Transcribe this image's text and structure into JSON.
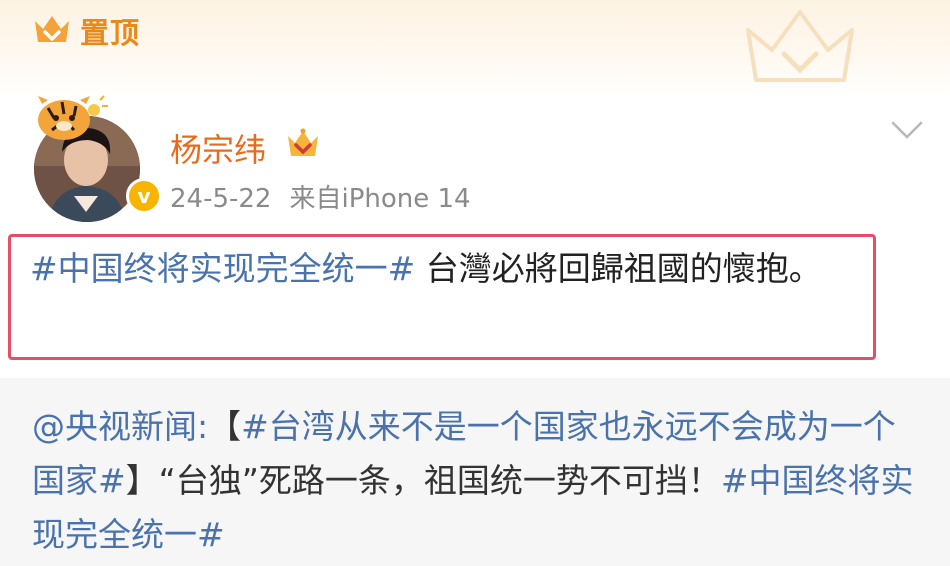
{
  "pinned": {
    "label": "置顶"
  },
  "post": {
    "username": "杨宗纬",
    "date": "24-5-22",
    "source": "来自iPhone 14",
    "topic_tag": "#中国终将实现完全统一#",
    "text": " 台灣必將回歸祖國的懷抱。"
  },
  "repost": {
    "mention": "@央视新闻:",
    "bracket_open": "【",
    "topic_tag": "#台湾从来不是一个国家也永远不会成为一个国家#",
    "bracket_close": "】",
    "body": "“台独”死路一条，祖国统一势不可挡！",
    "end_tag": "#中国终将实现完全统一#"
  },
  "colors": {
    "username": "#e86a1b",
    "link": "#4a73ad",
    "highlight_border": "#e54e68",
    "pinned": "#e8891a",
    "verified": "#f7b400"
  },
  "icons": {
    "pinned": "crown-icon",
    "vip": "vip-crown-icon",
    "verified": "verified-badge-icon",
    "menu": "chevron-down-icon"
  }
}
